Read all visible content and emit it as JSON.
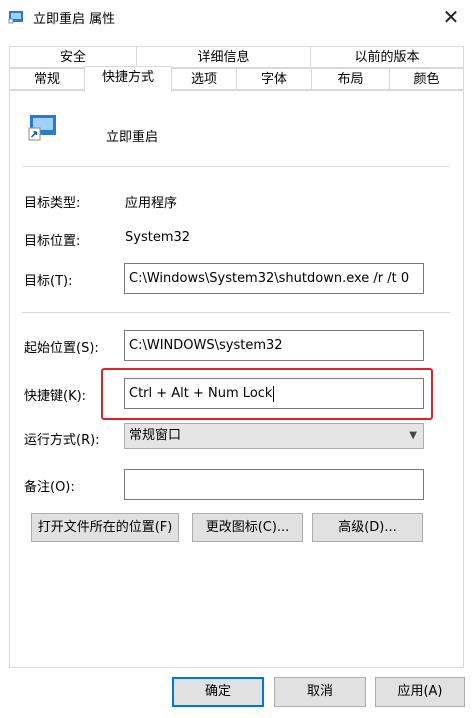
{
  "window": {
    "title": "立即重启 属性",
    "close_symbol": "✕"
  },
  "tabs_row1": [
    {
      "label": "安全"
    },
    {
      "label": "详细信息"
    },
    {
      "label": "以前的版本"
    }
  ],
  "tabs_row2": [
    {
      "label": "常规"
    },
    {
      "label": "快捷方式",
      "selected": true
    },
    {
      "label": "选项"
    },
    {
      "label": "字体"
    },
    {
      "label": "布局"
    },
    {
      "label": "颜色"
    }
  ],
  "shortcut": {
    "name": "立即重启",
    "target_type_label": "目标类型:",
    "target_type_value": "应用程序",
    "target_location_label": "目标位置:",
    "target_location_value": "System32",
    "target_label": "目标(T):",
    "target_value": "C:\\Windows\\System32\\shutdown.exe /r /t 0",
    "start_in_label": "起始位置(S):",
    "start_in_value": "C:\\WINDOWS\\system32",
    "hotkey_label": "快捷键(K):",
    "hotkey_value": "Ctrl + Alt + Num Lock",
    "run_label": "运行方式(R):",
    "run_value": "常规窗口",
    "comment_label": "备注(O):",
    "comment_value": ""
  },
  "panel_buttons": {
    "open_location": "打开文件所在的位置(F)",
    "change_icon": "更改图标(C)...",
    "advanced": "高级(D)..."
  },
  "dialog_buttons": {
    "ok": "确定",
    "cancel": "取消",
    "apply": "应用(A)"
  },
  "colors": {
    "accent": "#0078d7",
    "highlight": "#e0202a"
  }
}
